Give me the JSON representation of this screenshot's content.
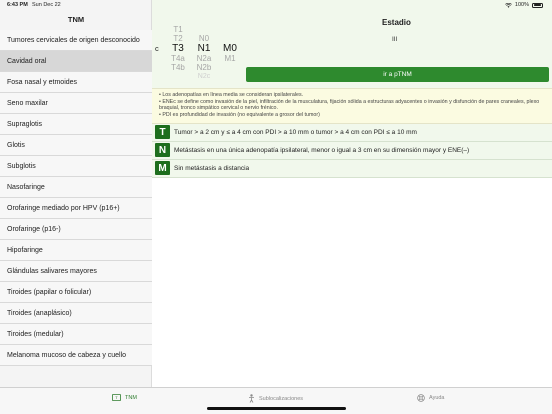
{
  "status_bar": {
    "time": "6:43 PM",
    "date": "Sun Dec 22",
    "battery": "100%"
  },
  "sidebar": {
    "title": "TNM",
    "items": [
      "Tumores cervicales de origen desconocido",
      "Cavidad oral",
      "Fosa nasal y etmoides",
      "Seno maxilar",
      "Supraglotis",
      "Glotis",
      "Subglotis",
      "Nasofaringe",
      "Orofaringe mediado por HPV (p16+)",
      "Orofaringe (p16-)",
      "Hipofaringe",
      "Glándulas salivares mayores",
      "Tiroides (papilar o folicular)",
      "Tiroides (anaplásico)",
      "Tiroides (medular)",
      "Melanoma mucoso de cabeza y cuello"
    ],
    "selected_index": 1
  },
  "main": {
    "estadio_title": "Estadio",
    "estadio_value": "III",
    "picker": {
      "prefix": "c",
      "t_options": [
        "T1",
        "T2",
        "T3",
        "T4a",
        "T4b"
      ],
      "n_options": [
        "N0",
        "N1",
        "N2a",
        "N2b",
        "N2c"
      ],
      "m_options": [
        "M0",
        "M1"
      ],
      "t_selected": "T3",
      "n_selected": "N1",
      "m_selected": "M0"
    },
    "ir_button_label": "ir a pTNM",
    "notes": [
      "• Los adenopatías en línea media se consideran ipsilaterales.",
      "• ENEc se define como invasión de la piel, infiltración de la musculatura, fijación sólida a estructuras adyacentes o invasión y disfunción de pares craneales, plexo braquial, tronco simpático cervical o nervio frénico.",
      "• PDI es profundidad de invasión (no equivalente a grosor del tumor)"
    ],
    "tnm_rows": [
      {
        "letter": "T",
        "text": "Tumor > a 2 cm y ≤ a 4 cm con PDI > a 10 mm o  tumor > a 4 cm con PDI ≤ a 10 mm"
      },
      {
        "letter": "N",
        "text": "Metástasis en una única adenopatía ipsilateral, menor o igual a 3 cm en su dimensión mayor y ENE(–)"
      },
      {
        "letter": "M",
        "text": "Sin metástasis a distancia"
      }
    ]
  },
  "tab_bar": {
    "tabs": [
      "TNM",
      "Sublocalizaciones",
      "Ayuda"
    ],
    "active": "TNM",
    "colors": {
      "active": "#2e7d2e",
      "inactive": "#888888"
    }
  }
}
